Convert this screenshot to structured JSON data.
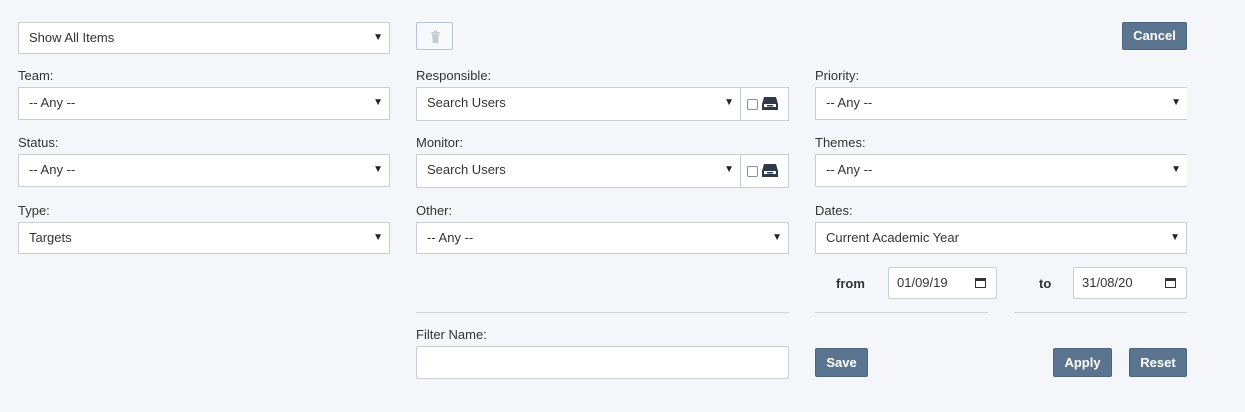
{
  "view_select": {
    "value": "Show All Items"
  },
  "buttons": {
    "cancel": "Cancel",
    "save": "Save",
    "apply": "Apply",
    "reset": "Reset",
    "trash_icon": "trash-icon"
  },
  "fields": {
    "team": {
      "label": "Team:",
      "value": "-- Any --"
    },
    "status": {
      "label": "Status:",
      "value": "-- Any --"
    },
    "type": {
      "label": "Type:",
      "value": "Targets"
    },
    "responsible": {
      "label": "Responsible:",
      "value": "Search Users",
      "icon": "inbox-icon"
    },
    "monitor": {
      "label": "Monitor:",
      "value": "Search Users",
      "icon": "inbox-icon"
    },
    "other": {
      "label": "Other:",
      "value": "-- Any --"
    },
    "priority": {
      "label": "Priority:",
      "value": "-- Any --"
    },
    "themes": {
      "label": "Themes:",
      "value": "-- Any --"
    },
    "dates": {
      "label": "Dates:",
      "value": "Current Academic Year"
    },
    "from": {
      "label": "from",
      "value": "01/09/19"
    },
    "to": {
      "label": "to",
      "value": "31/08/20"
    },
    "filter_name": {
      "label": "Filter Name:",
      "value": ""
    }
  },
  "colors": {
    "button_bg": "#5b7590",
    "page_bg": "#f4f6f9"
  }
}
